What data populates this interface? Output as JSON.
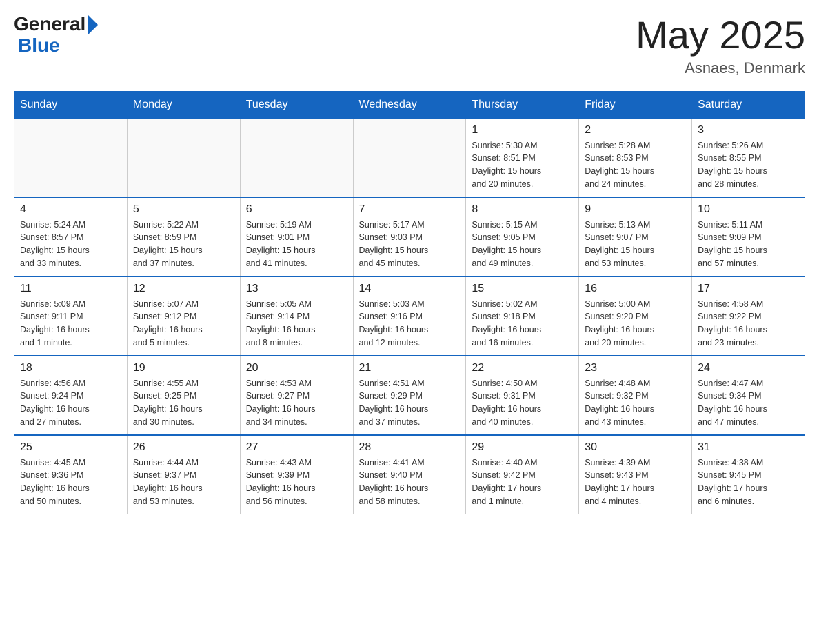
{
  "header": {
    "logo_general": "General",
    "logo_blue": "Blue",
    "month_title": "May 2025",
    "location": "Asnaes, Denmark"
  },
  "weekdays": [
    "Sunday",
    "Monday",
    "Tuesday",
    "Wednesday",
    "Thursday",
    "Friday",
    "Saturday"
  ],
  "weeks": [
    [
      {
        "day": "",
        "info": ""
      },
      {
        "day": "",
        "info": ""
      },
      {
        "day": "",
        "info": ""
      },
      {
        "day": "",
        "info": ""
      },
      {
        "day": "1",
        "info": "Sunrise: 5:30 AM\nSunset: 8:51 PM\nDaylight: 15 hours\nand 20 minutes."
      },
      {
        "day": "2",
        "info": "Sunrise: 5:28 AM\nSunset: 8:53 PM\nDaylight: 15 hours\nand 24 minutes."
      },
      {
        "day": "3",
        "info": "Sunrise: 5:26 AM\nSunset: 8:55 PM\nDaylight: 15 hours\nand 28 minutes."
      }
    ],
    [
      {
        "day": "4",
        "info": "Sunrise: 5:24 AM\nSunset: 8:57 PM\nDaylight: 15 hours\nand 33 minutes."
      },
      {
        "day": "5",
        "info": "Sunrise: 5:22 AM\nSunset: 8:59 PM\nDaylight: 15 hours\nand 37 minutes."
      },
      {
        "day": "6",
        "info": "Sunrise: 5:19 AM\nSunset: 9:01 PM\nDaylight: 15 hours\nand 41 minutes."
      },
      {
        "day": "7",
        "info": "Sunrise: 5:17 AM\nSunset: 9:03 PM\nDaylight: 15 hours\nand 45 minutes."
      },
      {
        "day": "8",
        "info": "Sunrise: 5:15 AM\nSunset: 9:05 PM\nDaylight: 15 hours\nand 49 minutes."
      },
      {
        "day": "9",
        "info": "Sunrise: 5:13 AM\nSunset: 9:07 PM\nDaylight: 15 hours\nand 53 minutes."
      },
      {
        "day": "10",
        "info": "Sunrise: 5:11 AM\nSunset: 9:09 PM\nDaylight: 15 hours\nand 57 minutes."
      }
    ],
    [
      {
        "day": "11",
        "info": "Sunrise: 5:09 AM\nSunset: 9:11 PM\nDaylight: 16 hours\nand 1 minute."
      },
      {
        "day": "12",
        "info": "Sunrise: 5:07 AM\nSunset: 9:12 PM\nDaylight: 16 hours\nand 5 minutes."
      },
      {
        "day": "13",
        "info": "Sunrise: 5:05 AM\nSunset: 9:14 PM\nDaylight: 16 hours\nand 8 minutes."
      },
      {
        "day": "14",
        "info": "Sunrise: 5:03 AM\nSunset: 9:16 PM\nDaylight: 16 hours\nand 12 minutes."
      },
      {
        "day": "15",
        "info": "Sunrise: 5:02 AM\nSunset: 9:18 PM\nDaylight: 16 hours\nand 16 minutes."
      },
      {
        "day": "16",
        "info": "Sunrise: 5:00 AM\nSunset: 9:20 PM\nDaylight: 16 hours\nand 20 minutes."
      },
      {
        "day": "17",
        "info": "Sunrise: 4:58 AM\nSunset: 9:22 PM\nDaylight: 16 hours\nand 23 minutes."
      }
    ],
    [
      {
        "day": "18",
        "info": "Sunrise: 4:56 AM\nSunset: 9:24 PM\nDaylight: 16 hours\nand 27 minutes."
      },
      {
        "day": "19",
        "info": "Sunrise: 4:55 AM\nSunset: 9:25 PM\nDaylight: 16 hours\nand 30 minutes."
      },
      {
        "day": "20",
        "info": "Sunrise: 4:53 AM\nSunset: 9:27 PM\nDaylight: 16 hours\nand 34 minutes."
      },
      {
        "day": "21",
        "info": "Sunrise: 4:51 AM\nSunset: 9:29 PM\nDaylight: 16 hours\nand 37 minutes."
      },
      {
        "day": "22",
        "info": "Sunrise: 4:50 AM\nSunset: 9:31 PM\nDaylight: 16 hours\nand 40 minutes."
      },
      {
        "day": "23",
        "info": "Sunrise: 4:48 AM\nSunset: 9:32 PM\nDaylight: 16 hours\nand 43 minutes."
      },
      {
        "day": "24",
        "info": "Sunrise: 4:47 AM\nSunset: 9:34 PM\nDaylight: 16 hours\nand 47 minutes."
      }
    ],
    [
      {
        "day": "25",
        "info": "Sunrise: 4:45 AM\nSunset: 9:36 PM\nDaylight: 16 hours\nand 50 minutes."
      },
      {
        "day": "26",
        "info": "Sunrise: 4:44 AM\nSunset: 9:37 PM\nDaylight: 16 hours\nand 53 minutes."
      },
      {
        "day": "27",
        "info": "Sunrise: 4:43 AM\nSunset: 9:39 PM\nDaylight: 16 hours\nand 56 minutes."
      },
      {
        "day": "28",
        "info": "Sunrise: 4:41 AM\nSunset: 9:40 PM\nDaylight: 16 hours\nand 58 minutes."
      },
      {
        "day": "29",
        "info": "Sunrise: 4:40 AM\nSunset: 9:42 PM\nDaylight: 17 hours\nand 1 minute."
      },
      {
        "day": "30",
        "info": "Sunrise: 4:39 AM\nSunset: 9:43 PM\nDaylight: 17 hours\nand 4 minutes."
      },
      {
        "day": "31",
        "info": "Sunrise: 4:38 AM\nSunset: 9:45 PM\nDaylight: 17 hours\nand 6 minutes."
      }
    ]
  ]
}
